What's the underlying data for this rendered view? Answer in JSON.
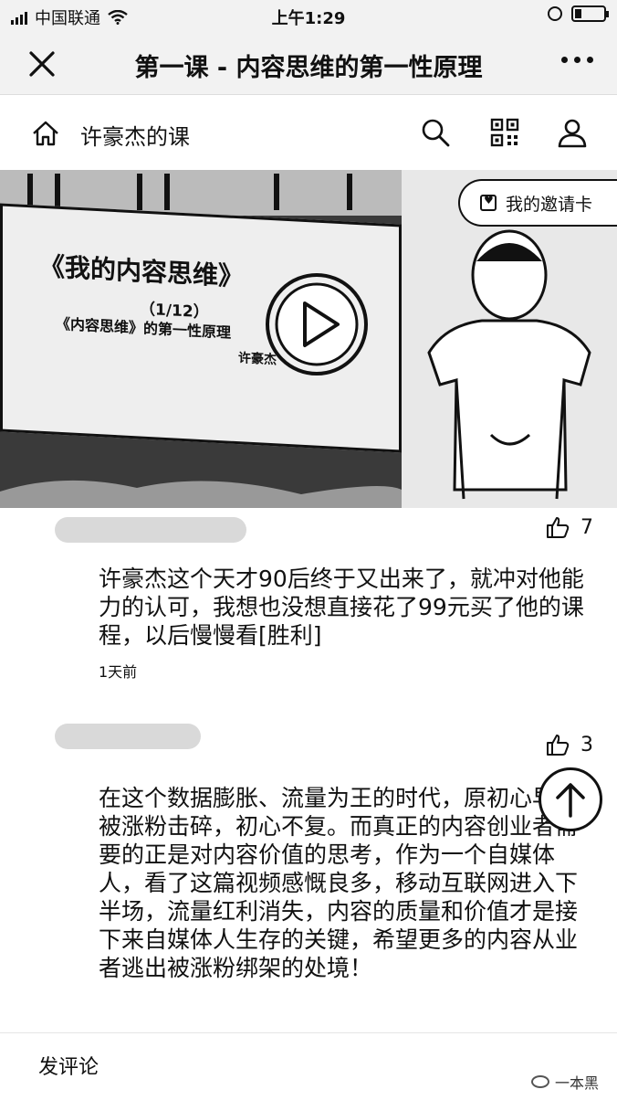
{
  "status_bar": {
    "carrier": "中国联通",
    "time": "上午1:29"
  },
  "nav": {
    "title": "第一课 - 内容思维的第一性原理"
  },
  "course": {
    "title": "许豪杰的课"
  },
  "video": {
    "slide_title": "《我的内容思维》",
    "slide_index": "（1/12）",
    "slide_subtitle": "《内容思维》的第一性原理",
    "slide_author": "许豪杰",
    "invite_label": "我的邀请卡"
  },
  "comments": [
    {
      "likes": "7",
      "text": "许豪杰这个天才90后终于又出来了，就冲对他能力的认可，我想也没想直接花了99元买了他的课程，以后慢慢看[胜利]",
      "time": "1天前"
    },
    {
      "likes": "3",
      "text": "在这个数据膨胀、流量为王的时代，原初心早已被涨粉击碎，初心不复。而真正的内容创业者需要的正是对内容价值的思考，作为一个自媒体人，看了这篇视频感慨良多，移动互联网进入下半场，流量红利消失，内容的质量和价值才是接下来自媒体人生存的关键，希望更多的内容从业者逃出被涨粉绑架的处境！"
    }
  ],
  "footer": {
    "write_comment": "发评论",
    "watermark": "一本黑"
  }
}
